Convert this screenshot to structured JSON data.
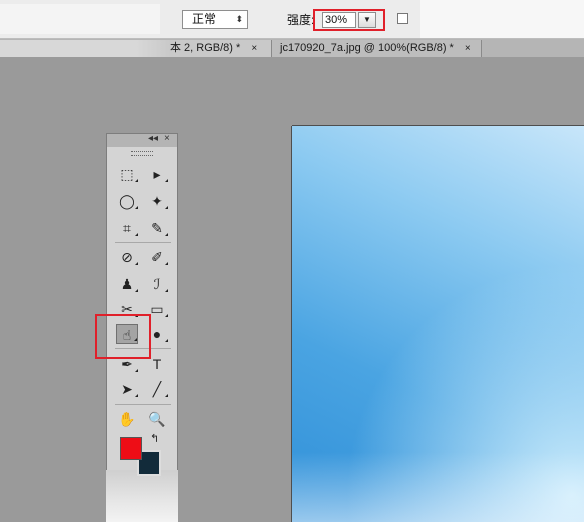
{
  "options_bar": {
    "blend_mode": "正常",
    "blend_arrows": "⬍",
    "strength_label": "强度:",
    "strength_value": "30%",
    "strength_dropdown_glyph": "▼"
  },
  "tabs": [
    {
      "title": "本 2, RGB/8) *",
      "close": "×"
    },
    {
      "title": "jc170920_7a.jpg @ 100%(RGB/8) *",
      "close": "×"
    }
  ],
  "tools_panel": {
    "collapse_glyph": "◂◂",
    "close_glyph": "×",
    "active_tool": "smudge-tool",
    "foreground_color": "#ee0d16",
    "background_color": "#122b3a",
    "swap_glyph": "↰",
    "tools": {
      "marquee": "⬚",
      "move": "▸",
      "lasso": "◯",
      "quick_select": "✦",
      "crop": "⌗",
      "eyedropper": "✎",
      "healing": "⊘",
      "brush": "✐",
      "stamp": "♟",
      "history_brush": "ℐ",
      "eraser": "✂",
      "gradient": "▭",
      "smudge": "☝",
      "dodge": "●",
      "pen": "✒",
      "type": "T",
      "path_select": "➤",
      "line": "╱",
      "hand": "✋",
      "zoom": "🔍"
    }
  },
  "accent_color": "#e0202a"
}
